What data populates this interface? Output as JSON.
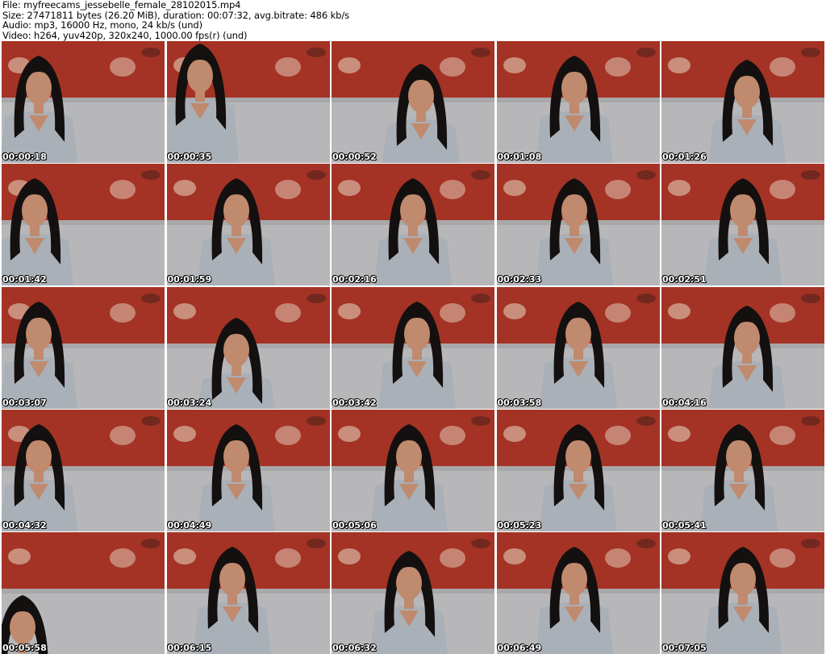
{
  "header": {
    "file_line": "File: myfreecams_jessebelle_female_28102015.mp4",
    "size_line": "Size: 27471811 bytes (26.20 MiB), duration: 00:07:32, avg.bitrate: 486 kb/s",
    "audio_line": "Audio: mp3, 16000 Hz, mono, 24 kb/s (und)",
    "video_line": "Video: h264, yuv420p, 320x240, 1000.00 fps(r) (und)"
  },
  "colors": {
    "wall_red": "#b23a2a",
    "wall_dark": "#7a1e16",
    "sofa_gray": "#b7b7b9",
    "shirt_gray": "#a9b0b8",
    "hair": "#141010",
    "skin": "#c08a6e"
  },
  "thumbnails": [
    {
      "time": "00:00:18"
    },
    {
      "time": "00:00:35"
    },
    {
      "time": "00:00:52"
    },
    {
      "time": "00:01:08"
    },
    {
      "time": "00:01:26"
    },
    {
      "time": "00:01:42"
    },
    {
      "time": "00:01:59"
    },
    {
      "time": "00:02:16"
    },
    {
      "time": "00:02:33"
    },
    {
      "time": "00:02:51"
    },
    {
      "time": "00:03:07"
    },
    {
      "time": "00:03:24"
    },
    {
      "time": "00:03:42"
    },
    {
      "time": "00:03:58"
    },
    {
      "time": "00:04:16"
    },
    {
      "time": "00:04:32"
    },
    {
      "time": "00:04:49"
    },
    {
      "time": "00:05:06"
    },
    {
      "time": "00:05:23"
    },
    {
      "time": "00:05:41"
    },
    {
      "time": "00:05:58"
    },
    {
      "time": "00:06:15"
    },
    {
      "time": "00:06:32"
    },
    {
      "time": "00:06:49"
    },
    {
      "time": "00:07:05"
    }
  ]
}
